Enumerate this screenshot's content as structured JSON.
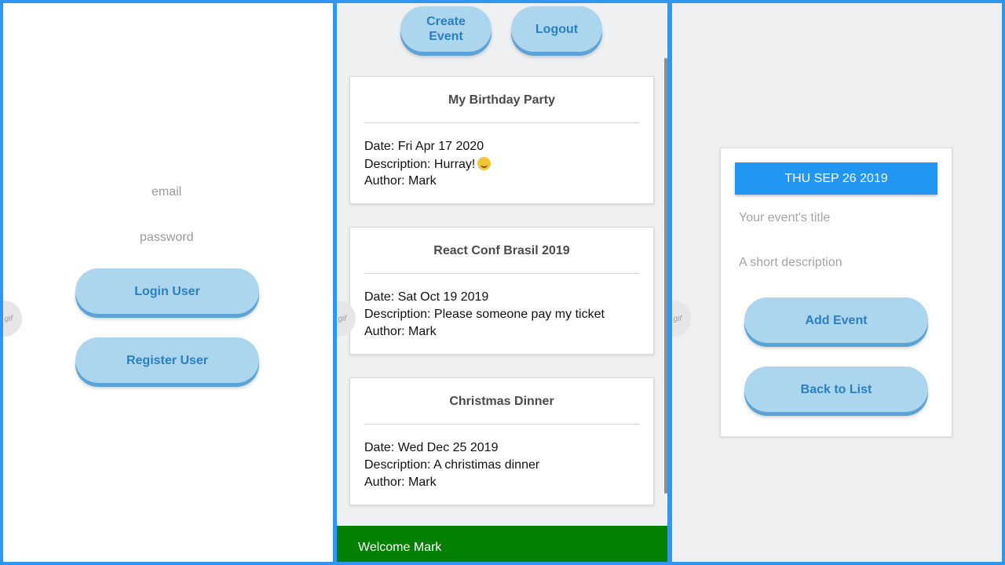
{
  "login": {
    "email_placeholder": "email",
    "password_placeholder": "password",
    "login_button": "Login User",
    "register_button": "Register User"
  },
  "gif_badge": "gif",
  "list": {
    "create_button_line1": "Create",
    "create_button_line2": "Event",
    "logout_button": "Logout",
    "events": [
      {
        "title": "My Birthday Party",
        "date": "Date: Fri Apr 17 2020",
        "description": "Description: Hurray!",
        "author": "Author: Mark"
      },
      {
        "title": "React Conf Brasil 2019",
        "date": "Date: Sat Oct 19 2019",
        "description": "Description: Please someone pay my ticket",
        "author": "Author: Mark"
      },
      {
        "title": "Christmas Dinner",
        "date": "Date: Wed Dec 25 2019",
        "description": "Description: A christimas dinner",
        "author": "Author: Mark"
      }
    ],
    "welcome_text": "Welcome Mark"
  },
  "create": {
    "date_button": "THU SEP 26 2019",
    "title_placeholder": "Your event's title",
    "description_placeholder": "A short description",
    "add_button": "Add Event",
    "back_button": "Back to List"
  },
  "colors": {
    "frame": "#3196ef",
    "button_fill": "#acd5ee",
    "button_text": "#2a7fc0",
    "date_button": "#2196f3",
    "welcome_bar": "#018001"
  }
}
